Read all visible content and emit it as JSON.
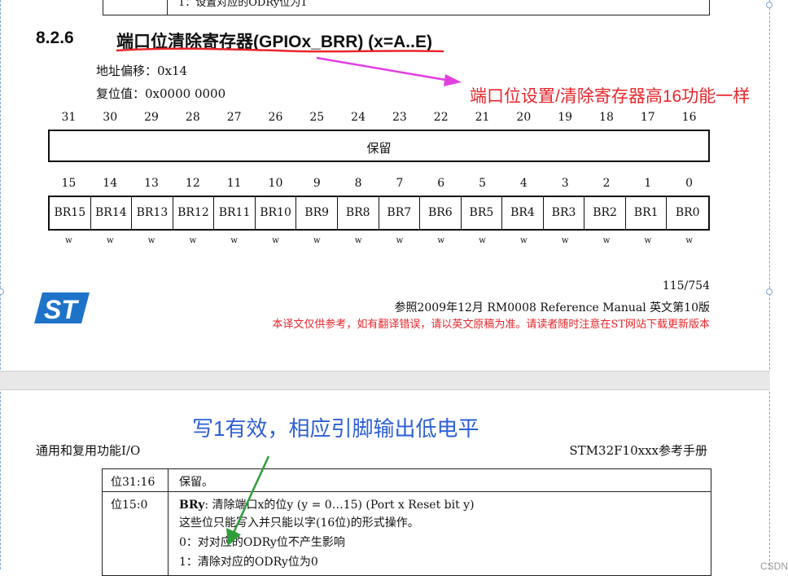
{
  "top_table_fragment": "1：设置对应的ODRy位为1",
  "section": {
    "number": "8.2.6",
    "title": "端口位清除寄存器(GPIOx_BRR) (x=A..E)",
    "address_offset": "地址偏移：0x14",
    "reset_value": "复位值：0x0000 0000"
  },
  "annotations": {
    "red_note": "端口位设置/清除寄存器高16功能一样",
    "blue_note": "写1有效，相应引脚输出低电平",
    "colors": {
      "red": "#e8262b",
      "blue": "#2e5fd6",
      "underline": "#e8262b",
      "arrow_magenta": "#e040e0",
      "arrow_green": "#2e9d3a"
    }
  },
  "register": {
    "high_bits": [
      "31",
      "30",
      "29",
      "28",
      "27",
      "26",
      "25",
      "24",
      "23",
      "22",
      "21",
      "20",
      "19",
      "18",
      "17",
      "16"
    ],
    "reserved_label": "保留",
    "low_bits": [
      "15",
      "14",
      "13",
      "12",
      "11",
      "10",
      "9",
      "8",
      "7",
      "6",
      "5",
      "4",
      "3",
      "2",
      "1",
      "0"
    ],
    "fields": [
      "BR15",
      "BR14",
      "BR13",
      "BR12",
      "BR11",
      "BR10",
      "BR9",
      "BR8",
      "BR7",
      "BR6",
      "BR5",
      "BR4",
      "BR3",
      "BR2",
      "BR1",
      "BR0"
    ],
    "access": [
      "w",
      "w",
      "w",
      "w",
      "w",
      "w",
      "w",
      "w",
      "w",
      "w",
      "w",
      "w",
      "w",
      "w",
      "w",
      "w"
    ]
  },
  "footer": {
    "logo_text": "ST",
    "page": "115/754",
    "reference": "参照2009年12月 RM0008 Reference Manual 英文第10版",
    "disclaimer": "本译文仅供参考，如有翻译错误，请以英文原稿为准。请读者随时注意在ST网站下载更新版本"
  },
  "next_page": {
    "left_header": "通用和复用功能I/O",
    "right_header": "STM32F10xxx参考手册",
    "rows": [
      {
        "bits": "位31:16",
        "desc": [
          "保留。"
        ]
      },
      {
        "bits": "位15:0",
        "desc_label": "BRy",
        "desc_first": ": 清除端口x的位y (y = 0…15) (Port x Reset bit y)",
        "desc": [
          "这些位只能写入并只能以字(16位)的形式操作。",
          "0：对对应的ODRy位不产生影响",
          "1：清除对应的ODRy位为0"
        ]
      }
    ]
  },
  "watermark": "CSDN"
}
